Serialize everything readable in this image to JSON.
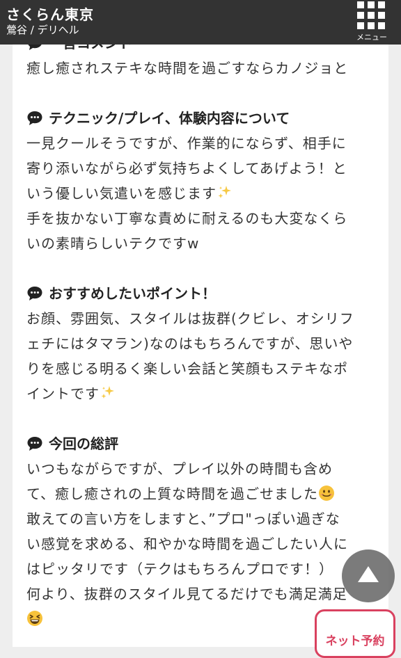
{
  "header": {
    "shop_name": "さくらん東京",
    "shop_sub": "鶯谷 / デリヘル",
    "menu_label": "メニュー"
  },
  "icons": {
    "section_icon": "speech-bubble-icon",
    "sparkle": "sparkles-emoji",
    "smile": "smiling-face-emoji",
    "grin": "grinning-squinting-face-emoji",
    "totop": "triangle-up-icon"
  },
  "colors": {
    "header_bg": "#333333",
    "accent": "#d9415f",
    "totop_bg": "#646464"
  },
  "sections": [
    {
      "heading": "一言コメント",
      "lines": [
        "癒し癒されステキな時間を過ごすならカノジョと"
      ]
    },
    {
      "heading": "テクニック/プレイ、体験内容について",
      "lines": [
        "一見クールそうですが、作業的にならず、相手に",
        "寄り添いながら必ず気持ちよくしてあげよう！と",
        "いう優しい気遣いを感じます",
        "手を抜かない丁寧な責めに耐えるのも大変なくら",
        "いの素晴らしいテクですw"
      ]
    },
    {
      "heading": "おすすめしたいポイント！",
      "lines": [
        "お顔、雰囲気、スタイルは抜群(クビレ、オシリフ",
        "ェチにはタマラン)なのはもちろんですが、思いや",
        "りを感じる明るく楽しい会話と笑顔もステキなポ",
        "イントです"
      ]
    },
    {
      "heading": "今回の総評",
      "lines": [
        "いつもながらですが、プレイ以外の時間も含め",
        "て、癒し癒されの上質な時間を過ごせました",
        "敢えての言い方をしますと、”プロ\"っぽい過ぎな",
        "い感覚を求める、和やかな時間を過ごしたい人に",
        "はピッタリです（テクはもちろんプロです！）",
        "何より、抜群のスタイル見てるだけでも満足満足"
      ]
    }
  ],
  "floating": {
    "reserve_label": "ネット予約"
  }
}
